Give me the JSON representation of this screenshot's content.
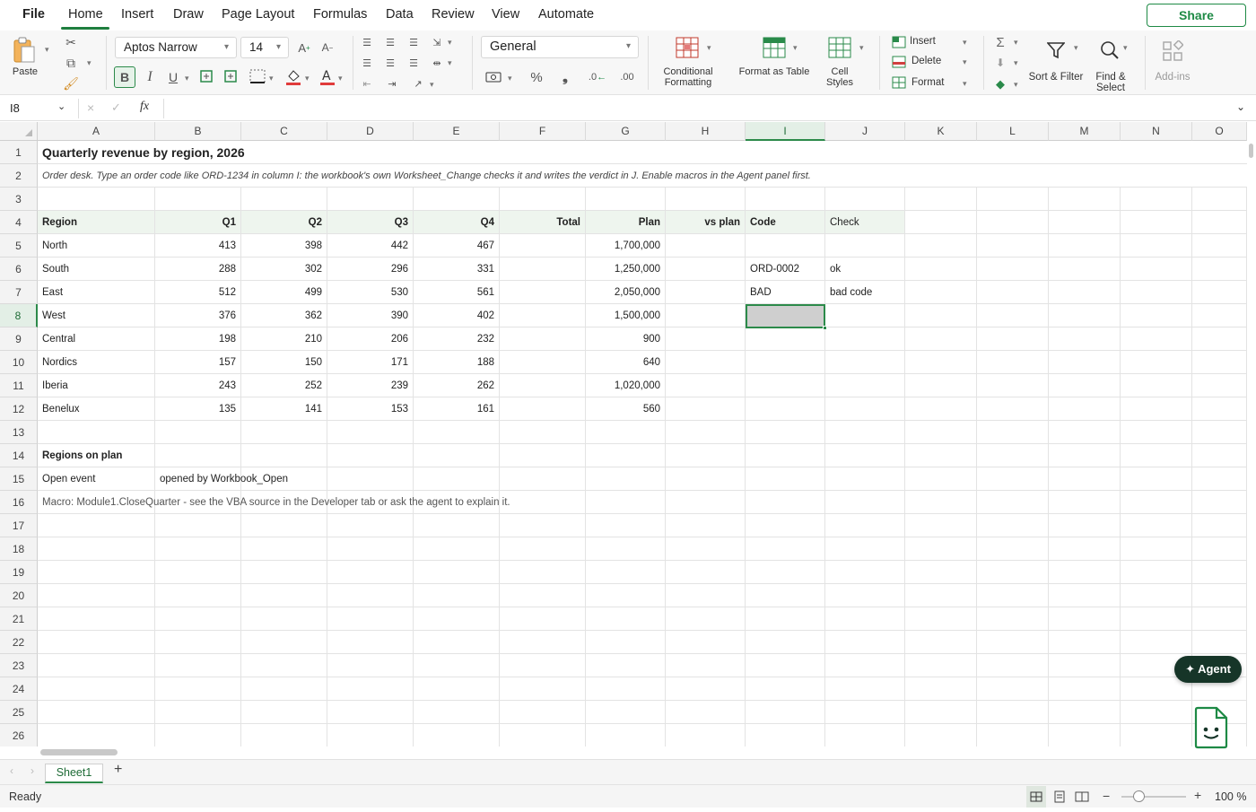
{
  "menu": {
    "file": "File",
    "tabs": [
      "Home",
      "Insert",
      "Draw",
      "Page Layout",
      "Formulas",
      "Data",
      "Review",
      "View",
      "Automate"
    ],
    "share": "Share"
  },
  "ribbon": {
    "paste": "Paste",
    "font_name": "Aptos Narrow",
    "font_size": "14",
    "number_format": "General",
    "conditional_formatting": "Conditional Formatting",
    "format_as_table": "Format as Table",
    "cell_styles": "Cell Styles",
    "insert": "Insert",
    "delete": "Delete",
    "format": "Format",
    "sort_filter": "Sort & Filter",
    "find_select": "Find & Select",
    "add_ins": "Add-ins"
  },
  "formula_bar": {
    "name_box": "I8",
    "fx": "fx",
    "content": ""
  },
  "columns": [
    "A",
    "B",
    "C",
    "D",
    "E",
    "F",
    "G",
    "H",
    "I",
    "J",
    "K",
    "L",
    "M",
    "N",
    "O"
  ],
  "selected_column": "I",
  "selected_row": "8",
  "rows": [
    "1",
    "2",
    "3",
    "4",
    "5",
    "6",
    "7",
    "8",
    "9",
    "10",
    "11",
    "12",
    "13",
    "14",
    "15",
    "16",
    "17",
    "18",
    "19",
    "20",
    "21",
    "22",
    "23",
    "24",
    "25",
    "26"
  ],
  "sheet": {
    "title": "Quarterly revenue by region, 2026",
    "note": "Order desk. Type an order code like ORD-1234 in column I: the workbook's own Worksheet_Change checks it and writes the verdict in J. Enable macros in the Agent panel first.",
    "headers": [
      "Region",
      "Q1",
      "Q2",
      "Q3",
      "Q4",
      "Total",
      "Plan",
      "vs plan",
      "Code",
      "Check"
    ],
    "data": [
      [
        "North",
        "413",
        "398",
        "442",
        "467",
        "",
        "1,700,000",
        "",
        "",
        ""
      ],
      [
        "South",
        "288",
        "302",
        "296",
        "331",
        "",
        "1,250,000",
        "",
        "ORD-0002",
        "ok"
      ],
      [
        "East",
        "512",
        "499",
        "530",
        "561",
        "",
        "2,050,000",
        "",
        "BAD",
        "bad code"
      ],
      [
        "West",
        "376",
        "362",
        "390",
        "402",
        "",
        "1,500,000",
        "",
        "",
        ""
      ],
      [
        "Central",
        "198",
        "210",
        "206",
        "232",
        "",
        "900",
        "",
        "",
        ""
      ],
      [
        "Nordics",
        "157",
        "150",
        "171",
        "188",
        "",
        "640",
        "",
        "",
        ""
      ],
      [
        "Iberia",
        "243",
        "252",
        "239",
        "262",
        "",
        "1,020,000",
        "",
        "",
        ""
      ],
      [
        "Benelux",
        "135",
        "141",
        "153",
        "161",
        "",
        "560",
        "",
        "",
        ""
      ]
    ],
    "regions_on_plan": "Regions on plan",
    "open_event_label": "Open event",
    "open_event_value": "opened by Workbook_Open",
    "macro_note": "Macro: Module1.CloseQuarter - see the VBA source in the Developer tab or ask the agent to explain it."
  },
  "agent_button": "✦ Agent",
  "sheet_tabs": [
    "Sheet1"
  ],
  "status": {
    "ready": "Ready",
    "zoom": "100 %"
  },
  "colors": {
    "accent": "#1e8a45",
    "selection": "#2c8a4a",
    "agent_bg": "#163528"
  }
}
